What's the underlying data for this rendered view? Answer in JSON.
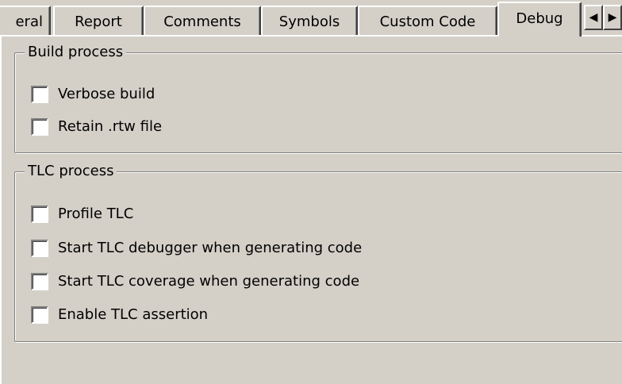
{
  "tabs": [
    {
      "label": "eral"
    },
    {
      "label": "Report"
    },
    {
      "label": "Comments"
    },
    {
      "label": "Symbols"
    },
    {
      "label": "Custom Code"
    },
    {
      "label": "Debug",
      "active": true
    }
  ],
  "tab_scroll": {
    "left_glyph": "◀",
    "right_glyph": "▶"
  },
  "build_process": {
    "title": "Build process",
    "options": [
      {
        "label": "Verbose build",
        "checked": false
      },
      {
        "label": "Retain .rtw file",
        "checked": false
      }
    ]
  },
  "tlc_process": {
    "title": "TLC process",
    "options": [
      {
        "label": "Profile TLC",
        "checked": false
      },
      {
        "label": "Start TLC debugger when generating code",
        "checked": false
      },
      {
        "label": "Start TLC coverage when generating code",
        "checked": false
      },
      {
        "label": "Enable TLC assertion",
        "checked": false
      }
    ]
  },
  "colors": {
    "face": "#d4d0c8",
    "highlight": "#ffffff",
    "shadow": "#808080",
    "dark_shadow": "#404040"
  }
}
